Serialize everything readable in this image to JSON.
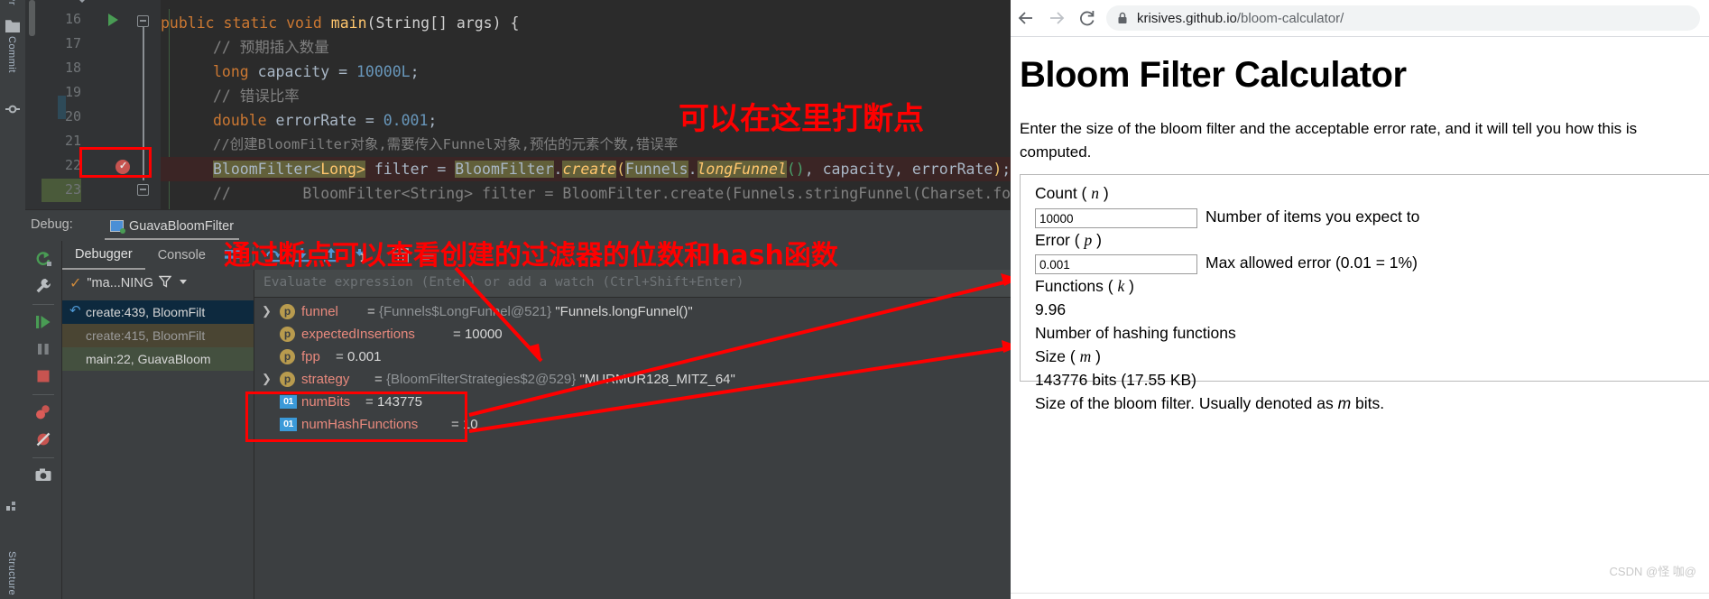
{
  "ide": {
    "toolstrip": {
      "project_label": "Pr",
      "commit_label": "Commit",
      "structure_label": "Structure"
    },
    "editor": {
      "lines": [
        {
          "num": "16",
          "text": "public static void main(String[] args) {"
        },
        {
          "num": "17",
          "text": "// 预期插入数量"
        },
        {
          "num": "18",
          "text": "long capacity = 10000L;"
        },
        {
          "num": "19",
          "text": "// 错误比率"
        },
        {
          "num": "20",
          "text": "double errorRate = 0.001;"
        },
        {
          "num": "21",
          "text": "//创建BloomFilter对象,需要传入Funnel对象,预估的元素个数,错误率"
        },
        {
          "num": "22",
          "text": "BloomFilter<Long> filter = BloomFilter.create(Funnels.longFunnel(), capacity, errorRate);"
        },
        {
          "num": "23",
          "text": "//        BloomFilter<String> filter = BloomFilter.create(Funnels.stringFunnel(Charset.for"
        }
      ],
      "line16": {
        "kw_public": "public",
        "kw_static": "static",
        "kw_void": "void",
        "name_main": "main",
        "rest": "(String[] args) {"
      },
      "line17": "// 预期插入数量",
      "line18": {
        "kw": "long",
        "name": " capacity = ",
        "val": "10000L",
        "semi": ";"
      },
      "line19": "// 错误比率",
      "line20": {
        "kw": "double",
        "name": " errorRate = ",
        "val": "0.001",
        "semi": ";"
      },
      "line21": "//创建BloomFilter对象,需要传入Funnel对象,预估的元素个数,错误率",
      "line22": {
        "t1": "BloomFilter<",
        "t2": "Long",
        "t3": ">",
        "t4": " filter = ",
        "t5": "BloomFilter",
        "t6": ".",
        "t7": "create",
        "t8": "(",
        "t9": "Funnels",
        "t10": ".",
        "t11": "longFunnel",
        "t12": "()",
        "t13": ", capacity, errorRate",
        "t14": ")",
        "t15": ";"
      },
      "line23": "//        BloomFilter<String> filter = BloomFilter.create(Funnels.stringFunnel(Charset.for"
    },
    "annotations": {
      "breakpoint_note": "可以在这里打断点",
      "debug_note": "通过断点可以查看创建的过滤器的位数和hash函数"
    },
    "debug": {
      "panel_label": "Debug:",
      "run_config": "GuavaBloomFilter",
      "tabs": [
        {
          "label": "Debugger",
          "active": true
        },
        {
          "label": "Console",
          "active": false
        }
      ],
      "thread": "\"ma...NING",
      "frames": [
        {
          "text": "create:439, BloomFilt",
          "state": "selected"
        },
        {
          "text": "create:415, BloomFilt",
          "state": "library"
        },
        {
          "text": "main:22, GuavaBloom",
          "state": "user"
        }
      ],
      "evaluate_placeholder": "Evaluate expression (Enter) or add a watch (Ctrl+Shift+Enter)",
      "variables": [
        {
          "badge": "p",
          "name": "funnel",
          "eq": " = ",
          "ref": "{Funnels$LongFunnel@521}",
          "str": "\"Funnels.longFunnel()\"",
          "expandable": true
        },
        {
          "badge": "p",
          "name": "expectedInsertions",
          "eq": " = ",
          "val": "10000",
          "expandable": false
        },
        {
          "badge": "p",
          "name": "fpp",
          "eq": " = ",
          "val": "0.001",
          "expandable": false
        },
        {
          "badge": "p",
          "name": "strategy",
          "eq": " = ",
          "ref": "{BloomFilterStrategies$2@529}",
          "str": "\"MURMUR128_MITZ_64\"",
          "expandable": true
        },
        {
          "badge": "01",
          "name": "numBits",
          "eq": " = ",
          "val": "143775",
          "expandable": false
        },
        {
          "badge": "01",
          "name": "numHashFunctions",
          "eq": " = ",
          "val": "10",
          "expandable": false
        }
      ]
    }
  },
  "browser": {
    "back_icon": "arrow-left-icon",
    "forward_icon": "arrow-right-icon",
    "reload_icon": "reload-icon",
    "lock_icon": "lock-icon",
    "url_main": "krisives.github.io",
    "url_path": "/bloom-calculator/",
    "page": {
      "title": "Bloom Filter Calculator",
      "description": "Enter the size of the bloom filter and the acceptable error rate, and it will tell you how this is computed.",
      "fields": [
        {
          "label_text": "Count (",
          "label_var": "n",
          "label_close": ")",
          "value": "10000",
          "help": "Number of items you expect to"
        },
        {
          "label_text": "Error (",
          "label_var": "p",
          "label_close": ")",
          "value": "0.001",
          "help": "Max allowed error (0.01 = 1%)"
        }
      ],
      "results": [
        {
          "label_text": "Functions (",
          "label_var": "k",
          "label_close": ")",
          "value": "9.96",
          "help": "Number of hashing functions"
        },
        {
          "label_text": "Size (",
          "label_var": "m",
          "label_close": ")",
          "value": "143776 bits (17.55 KB)",
          "help_a": "Size of the bloom filter. Usually denoted as ",
          "help_var": "m",
          "help_b": " bits."
        }
      ]
    },
    "watermark": "CSDN @怪 咖@"
  }
}
